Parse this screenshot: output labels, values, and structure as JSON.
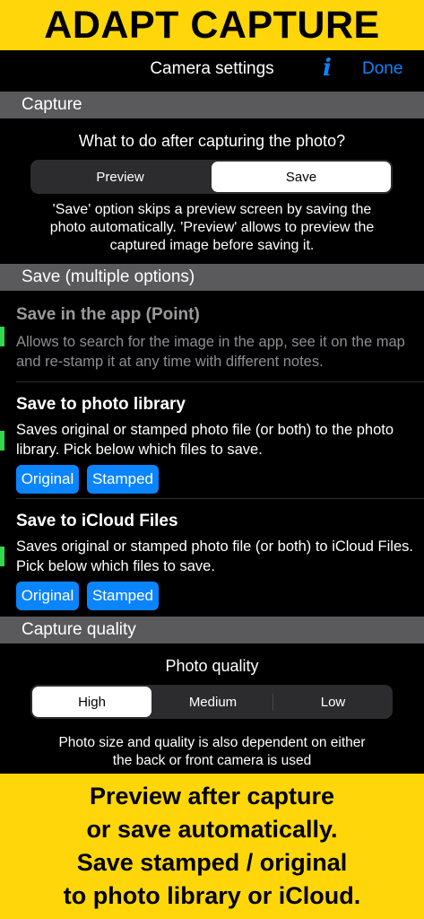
{
  "banner_top": "ADAPT CAPTURE",
  "navbar": {
    "title": "Camera settings",
    "info_icon": "i",
    "done_label": "Done"
  },
  "capture": {
    "header": "Capture",
    "question": "What to do after capturing the photo?",
    "segments": [
      "Preview",
      "Save"
    ],
    "selected": "Save",
    "description_lines": [
      "'Save' option skips a preview screen by saving the",
      "photo automatically. 'Preview' allows to preview the",
      "captured image before saving it."
    ]
  },
  "save_options": {
    "header": "Save (multiple options)",
    "items": [
      {
        "title": "Save in the app (Point)",
        "description": "Allows to search for the image in the app, see it on the map and re-stamp it at any time with different notes.",
        "enabled": false
      },
      {
        "title": "Save to photo library",
        "description": "Saves original or stamped photo file (or both) to the photo library. Pick below which files to save.",
        "chips": [
          "Original",
          "Stamped"
        ],
        "enabled": true
      },
      {
        "title": "Save to iCloud Files",
        "description": "Saves original or stamped photo file (or both) to iCloud Files. Pick below which files to save.",
        "chips": [
          "Original",
          "Stamped"
        ],
        "enabled": true
      }
    ]
  },
  "capture_quality": {
    "header": "Capture quality",
    "label": "Photo quality",
    "segments": [
      "High",
      "Medium",
      "Low"
    ],
    "selected": "High",
    "note_lines": [
      "Photo size and quality is also dependent on either",
      "the back or front camera is used"
    ]
  },
  "banner_bottom_lines": [
    "Preview after capture",
    "or save automatically.",
    "Save stamped / original",
    "to photo library or iCloud."
  ],
  "colors": {
    "banner": "#ffd60a",
    "accent": "#0a84ff",
    "indicator": "#32d74b",
    "section_header": "#5a5a5c"
  }
}
